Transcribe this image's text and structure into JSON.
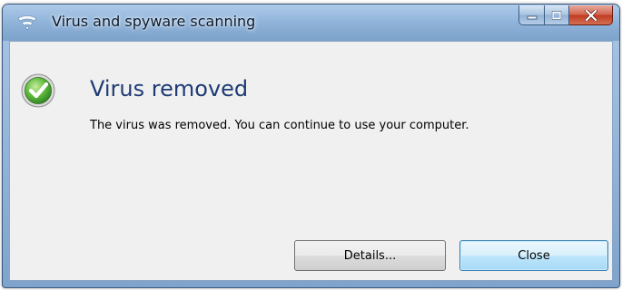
{
  "window": {
    "title": "Virus and spyware scanning",
    "title_icon": "shield-wifi-icon",
    "caption_buttons": {
      "minimize_icon": "minimize-icon",
      "maximize_icon": "maximize-icon",
      "close_icon": "close-icon"
    }
  },
  "dialog": {
    "status_icon": "check-circle-icon",
    "heading": "Virus removed",
    "message": "The virus was removed. You can continue to use your computer."
  },
  "buttons": {
    "details_label": "Details...",
    "close_label": "Close"
  },
  "colors": {
    "heading": "#1e3b73",
    "success_green": "#3fa83a",
    "close_button_accent": "#3c7fb1"
  }
}
